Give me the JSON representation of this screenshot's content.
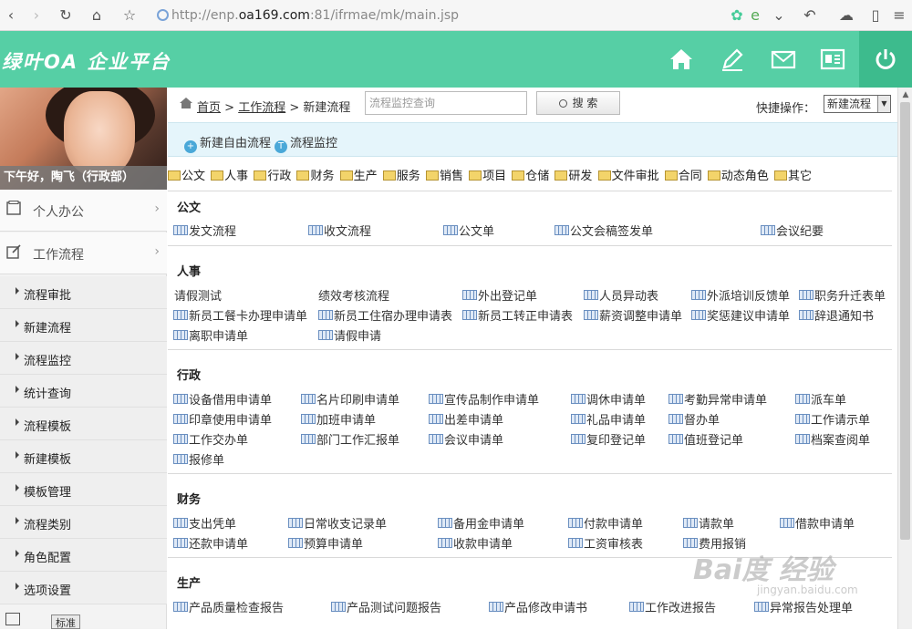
{
  "browser": {
    "url_prefix": "http://enp.",
    "url_host": "oa169.com",
    "url_suffix": ":81/ifrmae/mk/main.jsp"
  },
  "header": {
    "logo": "绿叶OA 企业平台",
    "icons": [
      "home-icon",
      "edit-icon",
      "mail-icon",
      "profile-card-icon",
      "power-icon"
    ]
  },
  "sidebar": {
    "greeting": "下午好，陶飞（行政部）",
    "main_items": [
      {
        "label": "个人办公",
        "arrow": "›"
      },
      {
        "label": "工作流程",
        "arrow": "›"
      }
    ],
    "sub_items": [
      "流程审批",
      "新建流程",
      "流程监控",
      "统计查询",
      "流程模板",
      "新建模板",
      "模板管理",
      "流程类别",
      "角色配置",
      "选项设置"
    ],
    "bottom_tool": "标准"
  },
  "breadcrumb": {
    "home": "首页",
    "sep": ">",
    "workflow": "工作流程",
    "current": "新建流程"
  },
  "search": {
    "placeholder": "流程监控查询",
    "button": "搜  索"
  },
  "quick": {
    "label": "快捷操作：",
    "selected": "新建流程"
  },
  "actions": {
    "new_free": "新建自由流程",
    "monitor": "流程监控"
  },
  "categories": [
    "公文",
    "人事",
    "行政",
    "财务",
    "生产",
    "服务",
    "销售",
    "项目",
    "仓储",
    "研发",
    "文件审批",
    "合同",
    "动态角色",
    "其它"
  ],
  "sections": {
    "gongwen": {
      "title": "公文",
      "items": [
        "发文流程",
        "收文流程",
        "公文单",
        "公文会稿签发单",
        "会议纪要"
      ]
    },
    "renshi": {
      "title": "人事",
      "items": [
        "请假测试",
        "绩效考核流程",
        "外出登记单",
        "人员异动表",
        "外派培训反馈单",
        "职务升迁表单",
        "新员工餐卡办理申请单",
        "新员工住宿办理申请表",
        "新员工转正申请表",
        "薪资调整申请单",
        "奖惩建议申请单",
        "辞退通知书",
        "离职申请单",
        "请假申请"
      ]
    },
    "xingzheng": {
      "title": "行政",
      "items": [
        "设备借用申请单",
        "名片印刷申请单",
        "宣传品制作申请单",
        "调休申请单",
        "考勤异常申请单",
        "派车单",
        "印章使用申请单",
        "加班申请单",
        "出差申请单",
        "礼品申请单",
        "督办单",
        "工作请示单",
        "工作交办单",
        "部门工作汇报单",
        "会议申请单",
        "复印登记单",
        "值班登记单",
        "档案查阅单",
        "报修单"
      ]
    },
    "caiwu": {
      "title": "财务",
      "items": [
        "支出凭单",
        "日常收支记录单",
        "备用金申请单",
        "付款申请单",
        "请款单",
        "借款申请单",
        "还款申请单",
        "预算申请单",
        "收款申请单",
        "工资审核表",
        "费用报销"
      ]
    },
    "shengchan": {
      "title": "生产",
      "items": [
        "产品质量检查报告",
        "产品测试问题报告",
        "产品修改申请书",
        "工作改进报告",
        "异常报告处理单"
      ]
    }
  },
  "watermark": {
    "brand": "Bai度 经验",
    "sub": "jingyan.baidu.com"
  }
}
